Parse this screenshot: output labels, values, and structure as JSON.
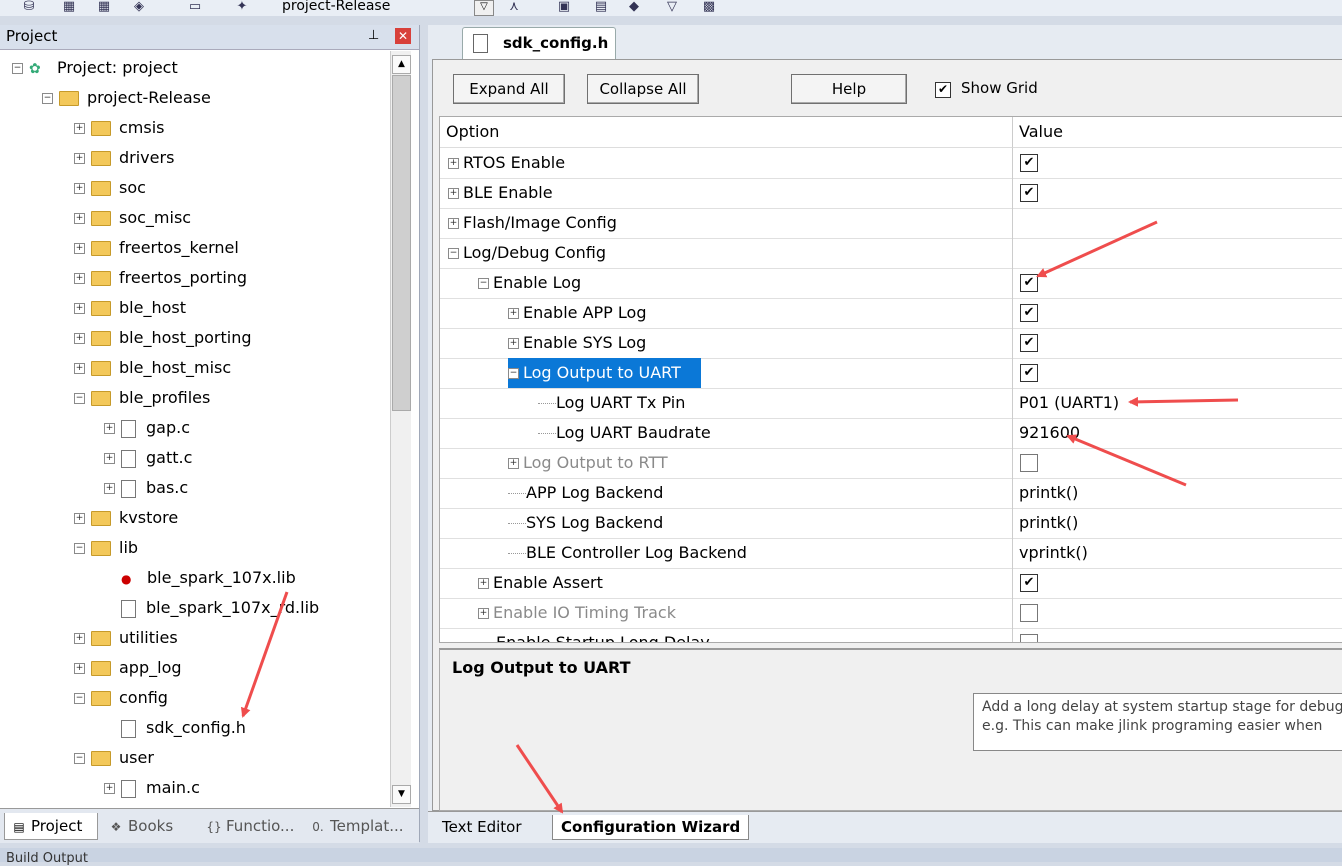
{
  "toolbar": {
    "target_combo_value": "project-Release",
    "combo_arrow": "▽"
  },
  "project_panel": {
    "title": "Project",
    "pin_glyph": "ᵖ",
    "close_glyph": "✕",
    "tree": [
      {
        "label": "Project: project",
        "kind": "project",
        "indent": 0,
        "expanded": true
      },
      {
        "label": "project-Release",
        "kind": "target",
        "indent": 1,
        "expanded": true
      },
      {
        "label": "cmsis",
        "kind": "folder",
        "indent": 2,
        "expanded": false
      },
      {
        "label": "drivers",
        "kind": "folder",
        "indent": 2,
        "expanded": false
      },
      {
        "label": "soc",
        "kind": "folder",
        "indent": 2,
        "expanded": false
      },
      {
        "label": "soc_misc",
        "kind": "folder",
        "indent": 2,
        "expanded": false
      },
      {
        "label": "freertos_kernel",
        "kind": "folder",
        "indent": 2,
        "expanded": false
      },
      {
        "label": "freertos_porting",
        "kind": "folder",
        "indent": 2,
        "expanded": false
      },
      {
        "label": "ble_host",
        "kind": "folder",
        "indent": 2,
        "expanded": false
      },
      {
        "label": "ble_host_porting",
        "kind": "folder",
        "indent": 2,
        "expanded": false
      },
      {
        "label": "ble_host_misc",
        "kind": "folder",
        "indent": 2,
        "expanded": false
      },
      {
        "label": "ble_profiles",
        "kind": "folder",
        "indent": 2,
        "expanded": true
      },
      {
        "label": "gap.c",
        "kind": "file",
        "indent": 3,
        "expanded": false
      },
      {
        "label": "gatt.c",
        "kind": "file",
        "indent": 3,
        "expanded": false
      },
      {
        "label": "bas.c",
        "kind": "file",
        "indent": 3,
        "expanded": false
      },
      {
        "label": "kvstore",
        "kind": "folder",
        "indent": 2,
        "expanded": false
      },
      {
        "label": "lib",
        "kind": "folder",
        "indent": 2,
        "expanded": true
      },
      {
        "label": "ble_spark_107x.lib",
        "kind": "lib",
        "indent": 3
      },
      {
        "label": "ble_spark_107x_rd.lib",
        "kind": "file",
        "indent": 3
      },
      {
        "label": "utilities",
        "kind": "folder",
        "indent": 2,
        "expanded": false
      },
      {
        "label": "app_log",
        "kind": "folder",
        "indent": 2,
        "expanded": false
      },
      {
        "label": "config",
        "kind": "folder",
        "indent": 2,
        "expanded": true
      },
      {
        "label": "sdk_config.h",
        "kind": "file",
        "indent": 3
      },
      {
        "label": "user",
        "kind": "folder",
        "indent": 2,
        "expanded": true
      },
      {
        "label": "main.c",
        "kind": "file",
        "indent": 3,
        "expanded": false
      }
    ],
    "bottom_tabs": [
      {
        "label": "Project",
        "active": true,
        "icon": "project-window-icon",
        "glyph": "▤"
      },
      {
        "label": "Books",
        "active": false,
        "icon": "books-icon",
        "glyph": "❖"
      },
      {
        "label": "Functio...",
        "active": false,
        "icon": "functions-icon",
        "glyph": "{}"
      },
      {
        "label": "Templat...",
        "active": false,
        "icon": "templates-icon",
        "glyph": "0."
      }
    ]
  },
  "editor": {
    "file_tab": "sdk_config.h",
    "buttons": {
      "expand_all": "Expand All",
      "collapse_all": "Collapse All",
      "help": "Help"
    },
    "show_grid": {
      "label": "Show Grid",
      "checked": true
    },
    "columns": {
      "option": "Option",
      "value": "Value"
    },
    "rows": [
      {
        "label": "RTOS Enable",
        "level": 0,
        "expander": "+",
        "value_type": "check",
        "checked": true
      },
      {
        "label": "BLE Enable",
        "level": 0,
        "expander": "+",
        "value_type": "check",
        "checked": true
      },
      {
        "label": "Flash/Image Config",
        "level": 0,
        "expander": "+",
        "value_type": "none"
      },
      {
        "label": "Log/Debug Config",
        "level": 0,
        "expander": "-",
        "value_type": "none"
      },
      {
        "label": "Enable Log",
        "level": 1,
        "expander": "-",
        "value_type": "check",
        "checked": true
      },
      {
        "label": "Enable APP Log",
        "level": 2,
        "expander": "+",
        "value_type": "check",
        "checked": true
      },
      {
        "label": "Enable SYS Log",
        "level": 2,
        "expander": "+",
        "value_type": "check",
        "checked": true
      },
      {
        "label": "Log Output to UART",
        "level": 2,
        "expander": "-",
        "value_type": "check",
        "checked": true,
        "selected": true
      },
      {
        "label": "Log UART Tx Pin",
        "level": 3,
        "expander": "",
        "value_type": "text",
        "value": "P01 (UART1)"
      },
      {
        "label": "Log UART Baudrate",
        "level": 3,
        "expander": "",
        "value_type": "text",
        "value": "921600"
      },
      {
        "label": "Log Output to RTT",
        "level": 2,
        "expander": "+",
        "value_type": "check",
        "checked": false,
        "dim": true
      },
      {
        "label": "APP Log Backend",
        "level": 2,
        "expander": "",
        "value_type": "text",
        "value": "printk()"
      },
      {
        "label": "SYS Log Backend",
        "level": 2,
        "expander": "",
        "value_type": "text",
        "value": "printk()"
      },
      {
        "label": "BLE Controller Log Backend",
        "level": 2,
        "expander": "",
        "value_type": "text",
        "value": "vprintk()"
      },
      {
        "label": "Enable Assert",
        "level": 1,
        "expander": "+",
        "value_type": "check",
        "checked": true
      },
      {
        "label": "Enable IO Timing Track",
        "level": 1,
        "expander": "+",
        "value_type": "check",
        "checked": false,
        "dim": true
      },
      {
        "label": "Enable Startup Long Delay",
        "level": 1,
        "expander": "",
        "value_type": "check",
        "checked": false
      }
    ],
    "description_title": "Log Output to UART",
    "tooltip_lines": [
      "Add a long delay at system startup stage for debug",
      "e.g. This can make jlink programing easier when"
    ],
    "bottom_tabs": [
      {
        "label": "Text Editor",
        "active": false
      },
      {
        "label": "Configuration Wizard",
        "active": true
      }
    ]
  },
  "status": {
    "text": "Build Output"
  },
  "colors": {
    "selection": "#0b78d7",
    "annotation_arrow": "#ef4d4d"
  }
}
